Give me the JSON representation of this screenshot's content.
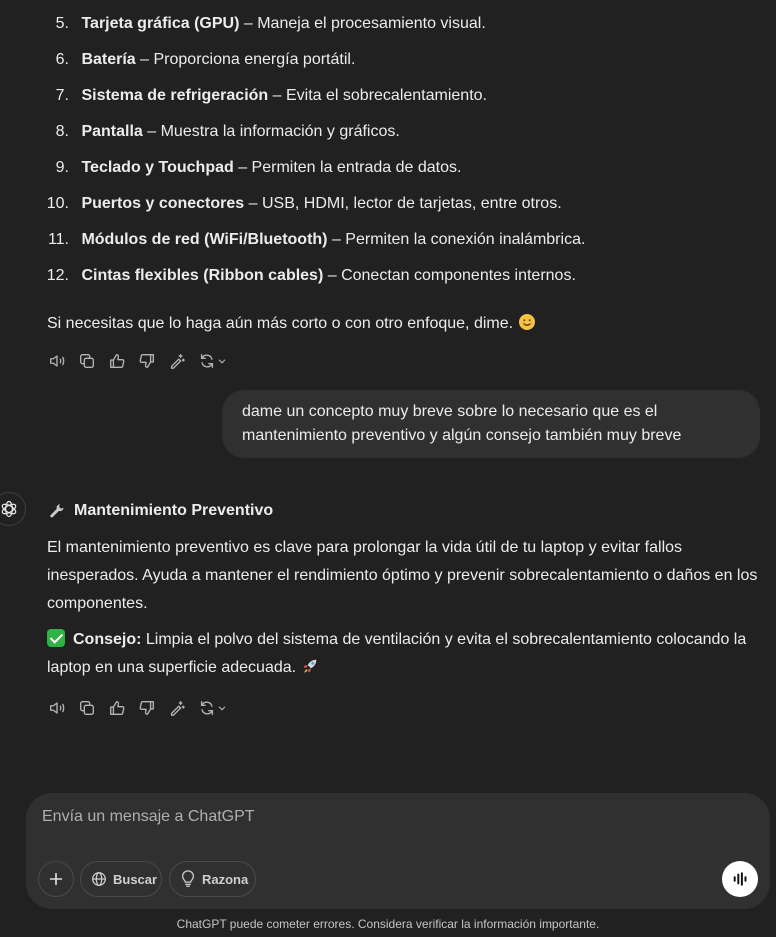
{
  "list_items": [
    {
      "num": "5.",
      "bold": "Tarjeta gráfica (GPU)",
      "rest": " – Maneja el procesamiento visual."
    },
    {
      "num": "6.",
      "bold": "Batería",
      "rest": " – Proporciona energía portátil."
    },
    {
      "num": "7.",
      "bold": "Sistema de refrigeración",
      "rest": " – Evita el sobrecalentamiento."
    },
    {
      "num": "8.",
      "bold": "Pantalla",
      "rest": " – Muestra la información y gráficos."
    },
    {
      "num": "9.",
      "bold": "Teclado y Touchpad",
      "rest": " – Permiten la entrada de datos."
    },
    {
      "num": "10.",
      "bold": "Puertos y conectores",
      "rest": " – USB, HDMI, lector de tarjetas, entre otros."
    },
    {
      "num": "11.",
      "bold": "Módulos de red (WiFi/Bluetooth)",
      "rest": " – Permiten la conexión inalámbrica."
    },
    {
      "num": "12.",
      "bold": "Cintas flexibles (Ribbon cables)",
      "rest": " – Conectan componentes internos."
    }
  ],
  "closing_text": "Si necesitas que lo haga aún más corto o con otro enfoque, dime.",
  "user_message": "dame un concepto muy breve sobre lo necesario que es el mantenimiento preventivo y algún consejo también muy breve",
  "reply": {
    "heading": "Mantenimiento Preventivo",
    "body": "El mantenimiento preventivo es clave para prolongar la vida útil de tu laptop y evitar fallos inesperados. Ayuda a mantener el rendimiento óptimo y prevenir sobrecalentamiento o daños en los componentes.",
    "tip_label": "Consejo:",
    "tip_text": " Limpia el polvo del sistema de ventilación y evita el sobrecalentamiento colocando la laptop en una superficie adecuada."
  },
  "composer": {
    "placeholder": "Envía un mensaje a ChatGPT",
    "search_label": "Buscar",
    "reason_label": "Razona"
  },
  "footer": "ChatGPT puede cometer errores. Considera verificar la información importante.",
  "colors": {
    "background": "#212121",
    "bubble": "#303030",
    "check": "#2fb344",
    "rocket": "#e05a4f"
  }
}
